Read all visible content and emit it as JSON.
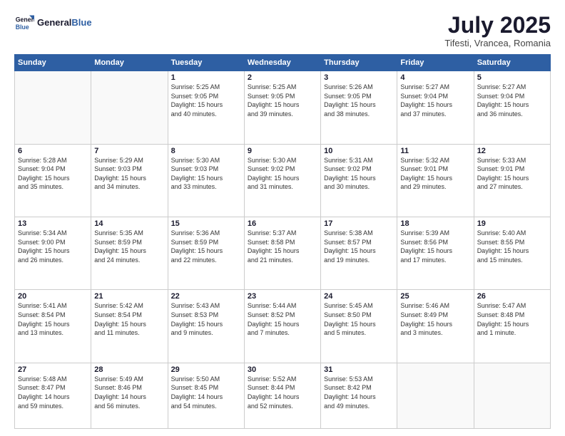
{
  "logo": {
    "line1": "General",
    "line2": "Blue"
  },
  "title": "July 2025",
  "subtitle": "Tifesti, Vrancea, Romania",
  "weekdays": [
    "Sunday",
    "Monday",
    "Tuesday",
    "Wednesday",
    "Thursday",
    "Friday",
    "Saturday"
  ],
  "weeks": [
    [
      {
        "num": "",
        "info": ""
      },
      {
        "num": "",
        "info": ""
      },
      {
        "num": "1",
        "info": "Sunrise: 5:25 AM\nSunset: 9:05 PM\nDaylight: 15 hours\nand 40 minutes."
      },
      {
        "num": "2",
        "info": "Sunrise: 5:25 AM\nSunset: 9:05 PM\nDaylight: 15 hours\nand 39 minutes."
      },
      {
        "num": "3",
        "info": "Sunrise: 5:26 AM\nSunset: 9:05 PM\nDaylight: 15 hours\nand 38 minutes."
      },
      {
        "num": "4",
        "info": "Sunrise: 5:27 AM\nSunset: 9:04 PM\nDaylight: 15 hours\nand 37 minutes."
      },
      {
        "num": "5",
        "info": "Sunrise: 5:27 AM\nSunset: 9:04 PM\nDaylight: 15 hours\nand 36 minutes."
      }
    ],
    [
      {
        "num": "6",
        "info": "Sunrise: 5:28 AM\nSunset: 9:04 PM\nDaylight: 15 hours\nand 35 minutes."
      },
      {
        "num": "7",
        "info": "Sunrise: 5:29 AM\nSunset: 9:03 PM\nDaylight: 15 hours\nand 34 minutes."
      },
      {
        "num": "8",
        "info": "Sunrise: 5:30 AM\nSunset: 9:03 PM\nDaylight: 15 hours\nand 33 minutes."
      },
      {
        "num": "9",
        "info": "Sunrise: 5:30 AM\nSunset: 9:02 PM\nDaylight: 15 hours\nand 31 minutes."
      },
      {
        "num": "10",
        "info": "Sunrise: 5:31 AM\nSunset: 9:02 PM\nDaylight: 15 hours\nand 30 minutes."
      },
      {
        "num": "11",
        "info": "Sunrise: 5:32 AM\nSunset: 9:01 PM\nDaylight: 15 hours\nand 29 minutes."
      },
      {
        "num": "12",
        "info": "Sunrise: 5:33 AM\nSunset: 9:01 PM\nDaylight: 15 hours\nand 27 minutes."
      }
    ],
    [
      {
        "num": "13",
        "info": "Sunrise: 5:34 AM\nSunset: 9:00 PM\nDaylight: 15 hours\nand 26 minutes."
      },
      {
        "num": "14",
        "info": "Sunrise: 5:35 AM\nSunset: 8:59 PM\nDaylight: 15 hours\nand 24 minutes."
      },
      {
        "num": "15",
        "info": "Sunrise: 5:36 AM\nSunset: 8:59 PM\nDaylight: 15 hours\nand 22 minutes."
      },
      {
        "num": "16",
        "info": "Sunrise: 5:37 AM\nSunset: 8:58 PM\nDaylight: 15 hours\nand 21 minutes."
      },
      {
        "num": "17",
        "info": "Sunrise: 5:38 AM\nSunset: 8:57 PM\nDaylight: 15 hours\nand 19 minutes."
      },
      {
        "num": "18",
        "info": "Sunrise: 5:39 AM\nSunset: 8:56 PM\nDaylight: 15 hours\nand 17 minutes."
      },
      {
        "num": "19",
        "info": "Sunrise: 5:40 AM\nSunset: 8:55 PM\nDaylight: 15 hours\nand 15 minutes."
      }
    ],
    [
      {
        "num": "20",
        "info": "Sunrise: 5:41 AM\nSunset: 8:54 PM\nDaylight: 15 hours\nand 13 minutes."
      },
      {
        "num": "21",
        "info": "Sunrise: 5:42 AM\nSunset: 8:54 PM\nDaylight: 15 hours\nand 11 minutes."
      },
      {
        "num": "22",
        "info": "Sunrise: 5:43 AM\nSunset: 8:53 PM\nDaylight: 15 hours\nand 9 minutes."
      },
      {
        "num": "23",
        "info": "Sunrise: 5:44 AM\nSunset: 8:52 PM\nDaylight: 15 hours\nand 7 minutes."
      },
      {
        "num": "24",
        "info": "Sunrise: 5:45 AM\nSunset: 8:50 PM\nDaylight: 15 hours\nand 5 minutes."
      },
      {
        "num": "25",
        "info": "Sunrise: 5:46 AM\nSunset: 8:49 PM\nDaylight: 15 hours\nand 3 minutes."
      },
      {
        "num": "26",
        "info": "Sunrise: 5:47 AM\nSunset: 8:48 PM\nDaylight: 15 hours\nand 1 minute."
      }
    ],
    [
      {
        "num": "27",
        "info": "Sunrise: 5:48 AM\nSunset: 8:47 PM\nDaylight: 14 hours\nand 59 minutes."
      },
      {
        "num": "28",
        "info": "Sunrise: 5:49 AM\nSunset: 8:46 PM\nDaylight: 14 hours\nand 56 minutes."
      },
      {
        "num": "29",
        "info": "Sunrise: 5:50 AM\nSunset: 8:45 PM\nDaylight: 14 hours\nand 54 minutes."
      },
      {
        "num": "30",
        "info": "Sunrise: 5:52 AM\nSunset: 8:44 PM\nDaylight: 14 hours\nand 52 minutes."
      },
      {
        "num": "31",
        "info": "Sunrise: 5:53 AM\nSunset: 8:42 PM\nDaylight: 14 hours\nand 49 minutes."
      },
      {
        "num": "",
        "info": ""
      },
      {
        "num": "",
        "info": ""
      }
    ]
  ]
}
